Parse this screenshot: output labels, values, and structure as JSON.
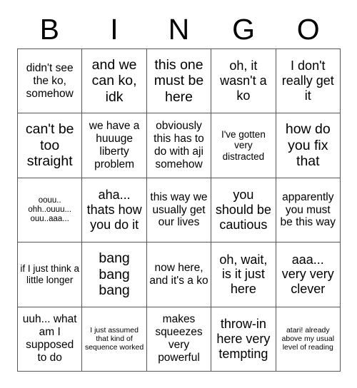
{
  "card": {
    "title": "BINGO",
    "header_letters": [
      "B",
      "I",
      "N",
      "G",
      "O"
    ],
    "rows": 5,
    "columns": 5,
    "colors": {
      "background": "#ffffff",
      "text": "#000000",
      "grid_line": "#555555"
    },
    "cells": [
      {
        "text": "didn't see the ko, somehow",
        "size": "md"
      },
      {
        "text": "and we can ko, idk",
        "size": "xl"
      },
      {
        "text": "this one must be here",
        "size": "xl"
      },
      {
        "text": "oh, it wasn't a ko",
        "size": "lg"
      },
      {
        "text": "I don't really get it",
        "size": "lg"
      },
      {
        "text": "can't be too straight",
        "size": "xl"
      },
      {
        "text": "we have a huuuge liberty problem",
        "size": "md"
      },
      {
        "text": "obviously this has to do with aji somehow",
        "size": "md"
      },
      {
        "text": "I've gotten very distracted",
        "size": "sm"
      },
      {
        "text": "how do you fix that",
        "size": "xl"
      },
      {
        "text": "oouu.. ohh..ouuu... ouu..aaa...",
        "size": "xs"
      },
      {
        "text": "aha... thats how you do it",
        "size": "lg"
      },
      {
        "text": "this way we usually get our lives",
        "size": "md"
      },
      {
        "text": "you should be cautious",
        "size": "lg"
      },
      {
        "text": "apparently you must be this way",
        "size": "md"
      },
      {
        "text": "if I just think a little longer",
        "size": "sm"
      },
      {
        "text": "bang bang bang",
        "size": "xl"
      },
      {
        "text": "now here, and it's a ko",
        "size": "md"
      },
      {
        "text": "oh, wait, is it just here",
        "size": "lg"
      },
      {
        "text": "aaa... very very clever",
        "size": "lg"
      },
      {
        "text": "uuh... what am I supposed to do",
        "size": "md"
      },
      {
        "text": "I just assumed that kind of sequence worked",
        "size": "xxs"
      },
      {
        "text": "makes squeezes very powerful",
        "size": "md"
      },
      {
        "text": "throw-in here very tempting",
        "size": "lg"
      },
      {
        "text": "atari! already above my usual level of reading",
        "size": "xxs"
      }
    ]
  }
}
